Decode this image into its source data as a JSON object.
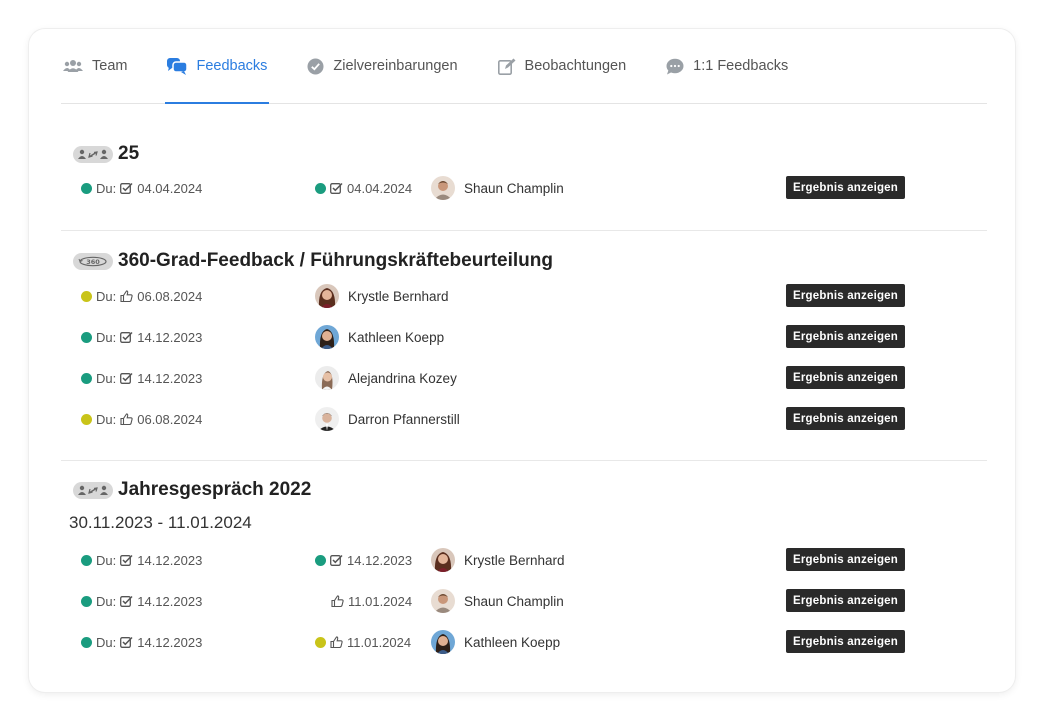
{
  "tabs": [
    {
      "label": "Team",
      "icon": "users-icon",
      "active": false
    },
    {
      "label": "Feedbacks",
      "icon": "chat-bubbles-icon",
      "active": true
    },
    {
      "label": "Zielvereinbarungen",
      "icon": "check-circle-icon",
      "active": false
    },
    {
      "label": "Beobachtungen",
      "icon": "edit-icon",
      "active": false
    },
    {
      "label": "1:1 Feedbacks",
      "icon": "chat-dots-icon",
      "active": false
    }
  ],
  "colors": {
    "accent": "#2b7de0",
    "green": "#1a9c7f",
    "yellow": "#c9c419",
    "button": "#2a2a2a"
  },
  "due_prefix": "Du:",
  "button_label": "Ergebnis anzeigen",
  "sections": [
    {
      "type_icon": "exchange-users-icon",
      "title": "25",
      "subtitle": "",
      "rows": [
        {
          "status": "green",
          "due_icon": "checkbox-icon",
          "due_date": "04.04.2024",
          "mid_status": "green",
          "mid_icon": "checkbox-icon",
          "mid_date": "04.04.2024",
          "person": "Shaun Champlin"
        }
      ]
    },
    {
      "type_icon": "360-icon",
      "title": "360-Grad-Feedback / Führungskräftebeurteilung",
      "subtitle": "",
      "rows": [
        {
          "status": "yellow",
          "due_icon": "thumbs-up-icon",
          "due_date": "06.08.2024",
          "person": "Krystle Bernhard"
        },
        {
          "status": "green",
          "due_icon": "checkbox-icon",
          "due_date": "14.12.2023",
          "person": "Kathleen Koepp"
        },
        {
          "status": "green",
          "due_icon": "checkbox-icon",
          "due_date": "14.12.2023",
          "person": "Alejandrina Kozey"
        },
        {
          "status": "yellow",
          "due_icon": "thumbs-up-icon",
          "due_date": "06.08.2024",
          "person": "Darron Pfannerstill"
        }
      ]
    },
    {
      "type_icon": "exchange-users-icon",
      "title": "Jahresgespräch 2022",
      "subtitle": "30.11.2023 - 11.01.2024",
      "rows": [
        {
          "status": "green",
          "due_icon": "checkbox-icon",
          "due_date": "14.12.2023",
          "mid_status": "green",
          "mid_icon": "checkbox-icon",
          "mid_date": "14.12.2023",
          "person": "Krystle Bernhard"
        },
        {
          "status": "green",
          "due_icon": "checkbox-icon",
          "due_date": "14.12.2023",
          "mid_status": "none",
          "mid_icon": "thumbs-up-icon",
          "mid_date": "11.01.2024",
          "person": "Shaun Champlin"
        },
        {
          "status": "green",
          "due_icon": "checkbox-icon",
          "due_date": "14.12.2023",
          "mid_status": "yellow",
          "mid_icon": "thumbs-up-icon",
          "mid_date": "11.01.2024",
          "person": "Kathleen Koepp"
        }
      ]
    }
  ]
}
